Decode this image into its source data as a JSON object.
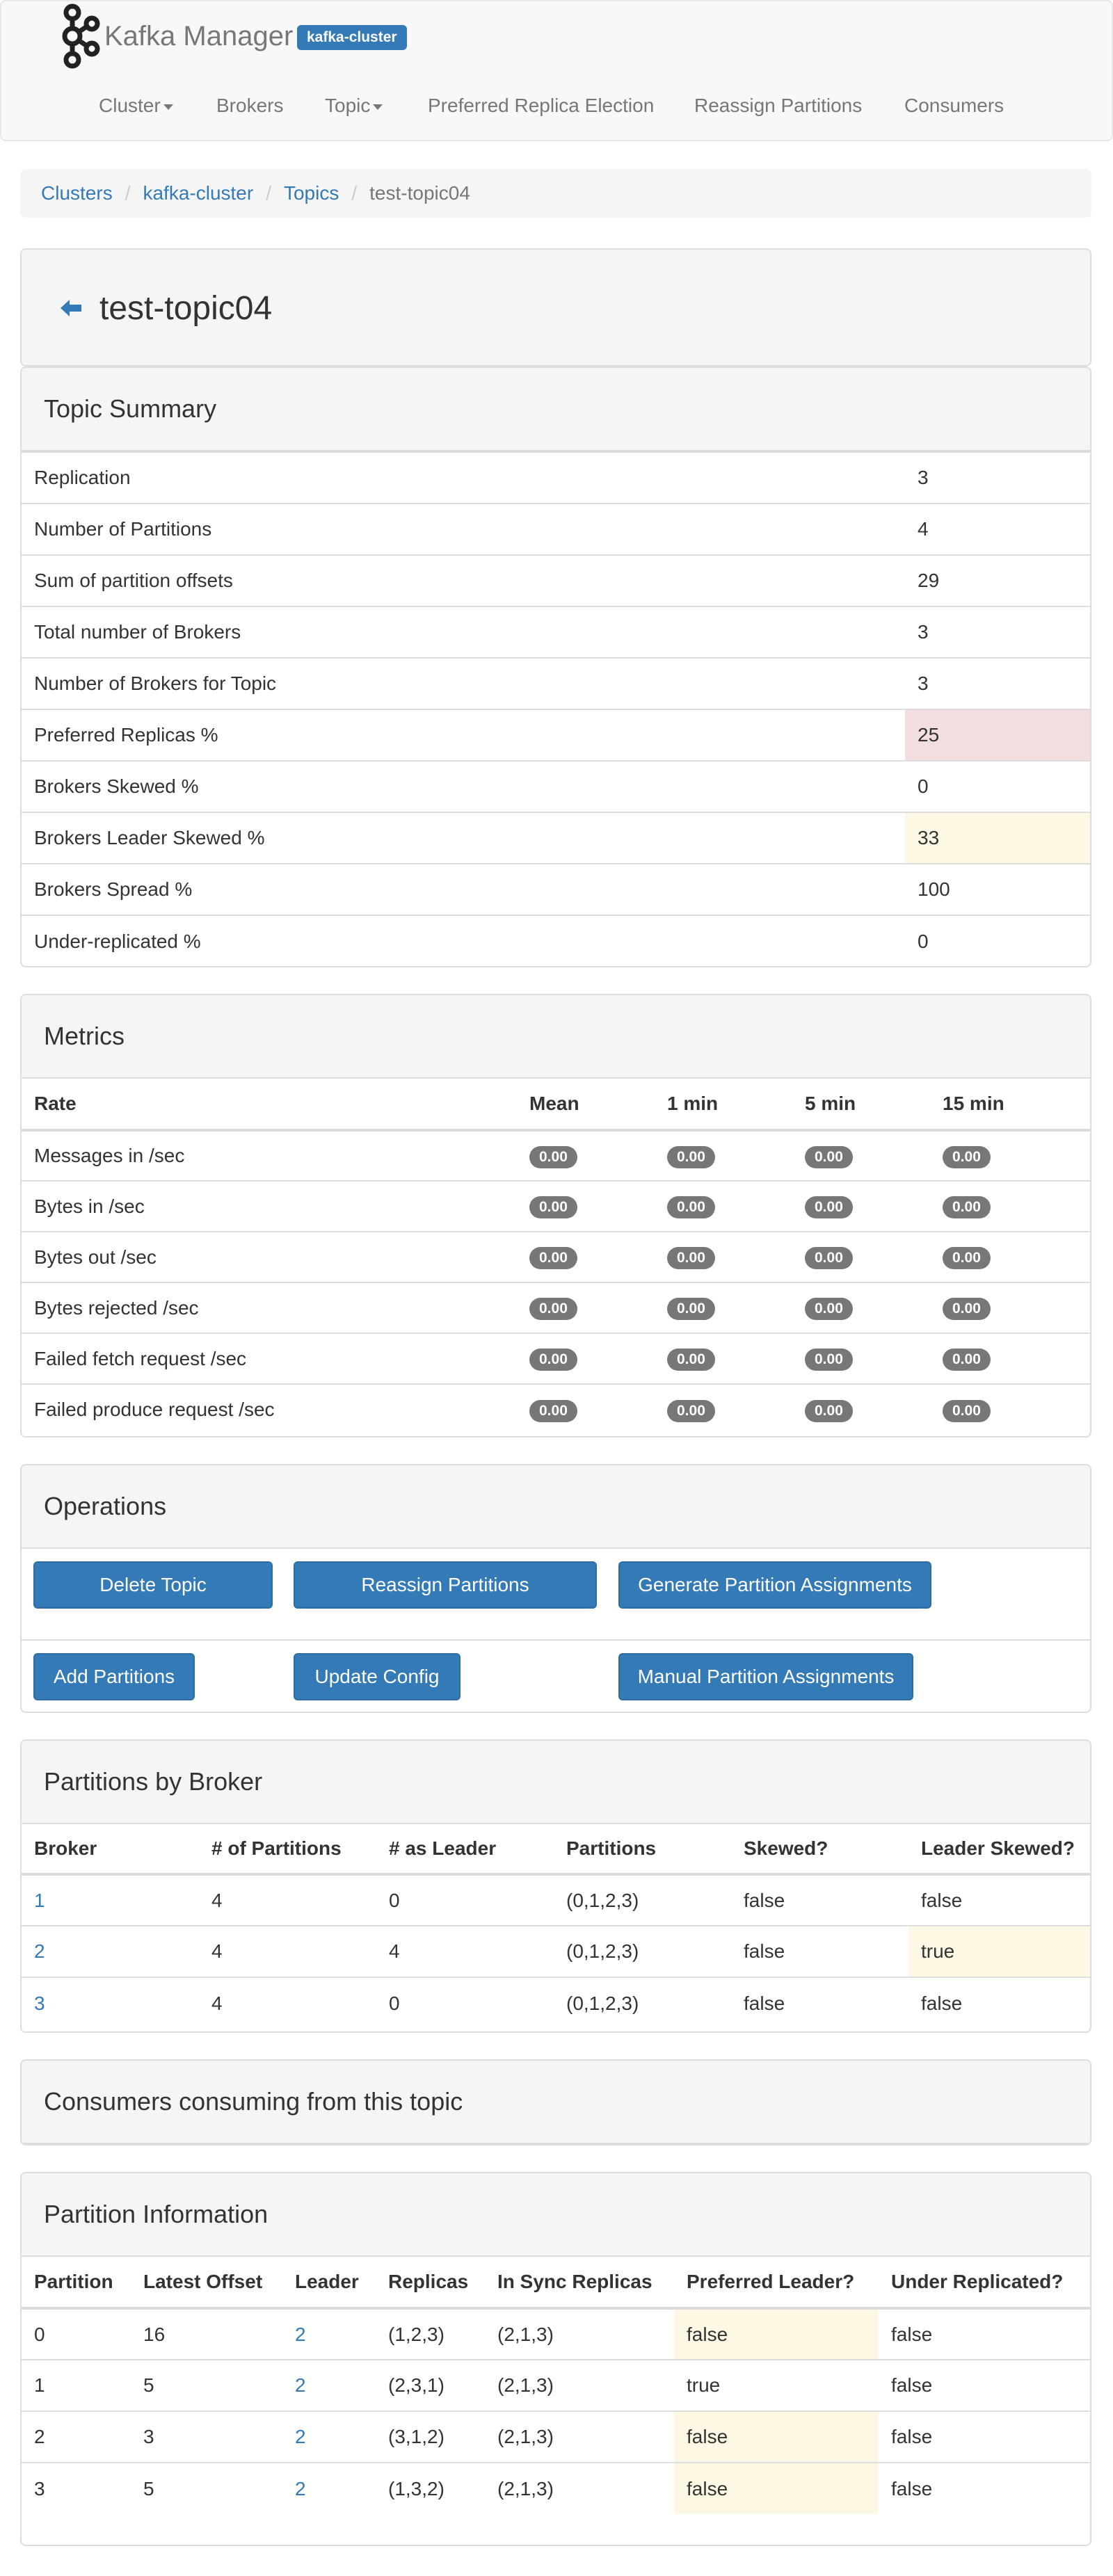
{
  "navbar": {
    "brand": "Kafka Manager",
    "cluster_badge": "kafka-cluster",
    "items": [
      "Cluster",
      "Brokers",
      "Topic",
      "Preferred Replica Election",
      "Reassign Partitions",
      "Consumers"
    ]
  },
  "breadcrumb": [
    "Clusters",
    "kafka-cluster",
    "Topics",
    "test-topic04"
  ],
  "page_title": "test-topic04",
  "topic_summary": {
    "title": "Topic Summary",
    "rows": [
      {
        "label": "Replication",
        "value": "3"
      },
      {
        "label": "Number of Partitions",
        "value": "4"
      },
      {
        "label": "Sum of partition offsets",
        "value": "29"
      },
      {
        "label": "Total number of Brokers",
        "value": "3"
      },
      {
        "label": "Number of Brokers for Topic",
        "value": "3"
      },
      {
        "label": "Preferred Replicas %",
        "value": "25"
      },
      {
        "label": "Brokers Skewed %",
        "value": "0"
      },
      {
        "label": "Brokers Leader Skewed %",
        "value": "33"
      },
      {
        "label": "Brokers Spread %",
        "value": "100"
      },
      {
        "label": "Under-replicated %",
        "value": "0"
      }
    ],
    "colors": {
      "danger": "#f2dede",
      "warning": "#fcf8e3"
    }
  },
  "metrics": {
    "title": "Metrics",
    "headers": [
      "Rate",
      "Mean",
      "1 min",
      "5 min",
      "15 min"
    ],
    "rows": [
      {
        "rate": "Messages in /sec",
        "values": [
          "0.00",
          "0.00",
          "0.00",
          "0.00"
        ]
      },
      {
        "rate": "Bytes in /sec",
        "values": [
          "0.00",
          "0.00",
          "0.00",
          "0.00"
        ]
      },
      {
        "rate": "Bytes out /sec",
        "values": [
          "0.00",
          "0.00",
          "0.00",
          "0.00"
        ]
      },
      {
        "rate": "Bytes rejected /sec",
        "values": [
          "0.00",
          "0.00",
          "0.00",
          "0.00"
        ]
      },
      {
        "rate": "Failed fetch request /sec",
        "values": [
          "0.00",
          "0.00",
          "0.00",
          "0.00"
        ]
      },
      {
        "rate": "Failed produce request /sec",
        "values": [
          "0.00",
          "0.00",
          "0.00",
          "0.00"
        ]
      }
    ]
  },
  "operations": {
    "title": "Operations",
    "buttons": [
      "Delete Topic",
      "Reassign Partitions",
      "Generate Partition Assignments",
      "Add Partitions",
      "Update Config",
      "Manual Partition Assignments"
    ]
  },
  "partitions_by_broker": {
    "title": "Partitions by Broker",
    "headers": [
      "Broker",
      "# of Partitions",
      "# as Leader",
      "Partitions",
      "Skewed?",
      "Leader Skewed?"
    ],
    "rows": [
      {
        "broker": "1",
        "num_partitions": "4",
        "as_leader": "0",
        "partitions": "(0,1,2,3)",
        "skewed": "false",
        "leader_skewed": "false"
      },
      {
        "broker": "2",
        "num_partitions": "4",
        "as_leader": "4",
        "partitions": "(0,1,2,3)",
        "skewed": "false",
        "leader_skewed": "true"
      },
      {
        "broker": "3",
        "num_partitions": "4",
        "as_leader": "0",
        "partitions": "(0,1,2,3)",
        "skewed": "false",
        "leader_skewed": "false"
      }
    ]
  },
  "consumers": {
    "title": "Consumers consuming from this topic"
  },
  "partition_information": {
    "title": "Partition Information",
    "headers": [
      "Partition",
      "Latest Offset",
      "Leader",
      "Replicas",
      "In Sync Replicas",
      "Preferred Leader?",
      "Under Replicated?"
    ],
    "rows": [
      {
        "partition": "0",
        "latest_offset": "16",
        "leader": "2",
        "replicas": "(1,2,3)",
        "isr": "(2,1,3)",
        "preferred_leader": "false",
        "under_replicated": "false"
      },
      {
        "partition": "1",
        "latest_offset": "5",
        "leader": "2",
        "replicas": "(2,3,1)",
        "isr": "(2,1,3)",
        "preferred_leader": "true",
        "under_replicated": "false"
      },
      {
        "partition": "2",
        "latest_offset": "3",
        "leader": "2",
        "replicas": "(3,1,2)",
        "isr": "(2,1,3)",
        "preferred_leader": "false",
        "under_replicated": "false"
      },
      {
        "partition": "3",
        "latest_offset": "5",
        "leader": "2",
        "replicas": "(1,3,2)",
        "isr": "(2,1,3)",
        "preferred_leader": "false",
        "under_replicated": "false"
      }
    ]
  }
}
